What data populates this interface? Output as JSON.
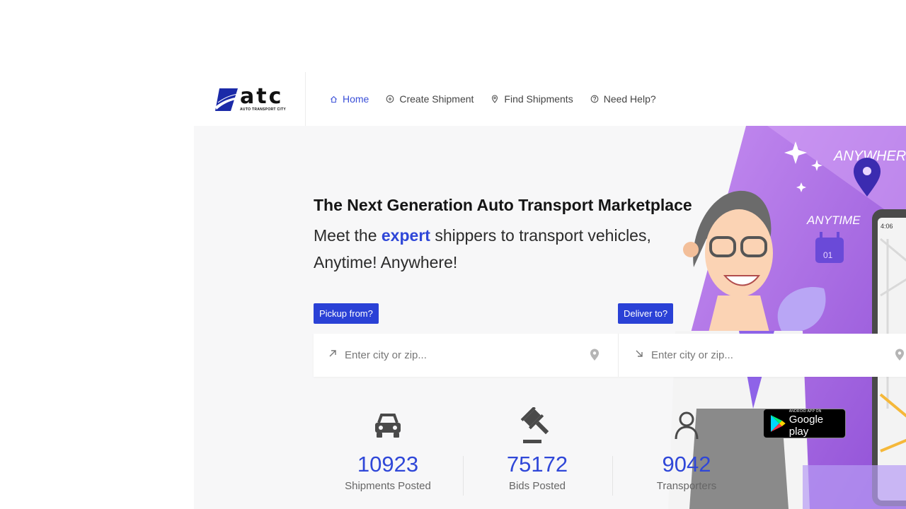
{
  "brand": {
    "logo_word": "atc",
    "logo_sub": "AUTO TRANSPORT CITY"
  },
  "nav": [
    {
      "label": "Home",
      "icon": "home-icon",
      "active": true
    },
    {
      "label": "Create Shipment",
      "icon": "plus-circle-icon"
    },
    {
      "label": "Find Shipments",
      "icon": "map-pin-icon"
    },
    {
      "label": "Need Help?",
      "icon": "help-circle-icon"
    }
  ],
  "hero": {
    "headline": "The Next Generation Auto Transport Marketplace",
    "sub_prefix": "Meet the ",
    "sub_accent": "expert",
    "sub_suffix": " shippers to transport vehicles, Anytime! Anywhere!",
    "art_word_anywhere": "ANYWHERE",
    "art_word_anytime": "ANYTIME",
    "art_calendar_day": "01",
    "art_phone_time": "4:06"
  },
  "search": {
    "pickup_label": "Pickup from?",
    "deliver_label": "Deliver to?",
    "pickup_placeholder": "Enter city or zip...",
    "deliver_placeholder": "Enter city or zip..."
  },
  "stats": [
    {
      "value": "10923",
      "label": "Shipments Posted",
      "icon": "car-icon"
    },
    {
      "value": "75172",
      "label": "Bids Posted",
      "icon": "gavel-icon"
    },
    {
      "value": "9042",
      "label": "Transporters",
      "icon": "user-icon"
    }
  ],
  "store_badge": {
    "small": "ANDROID APP ON",
    "big": "Google play"
  },
  "colors": {
    "accent": "#2f47d8",
    "hero_bg": "#f7f7f8",
    "art_purple": "#a865e0"
  }
}
